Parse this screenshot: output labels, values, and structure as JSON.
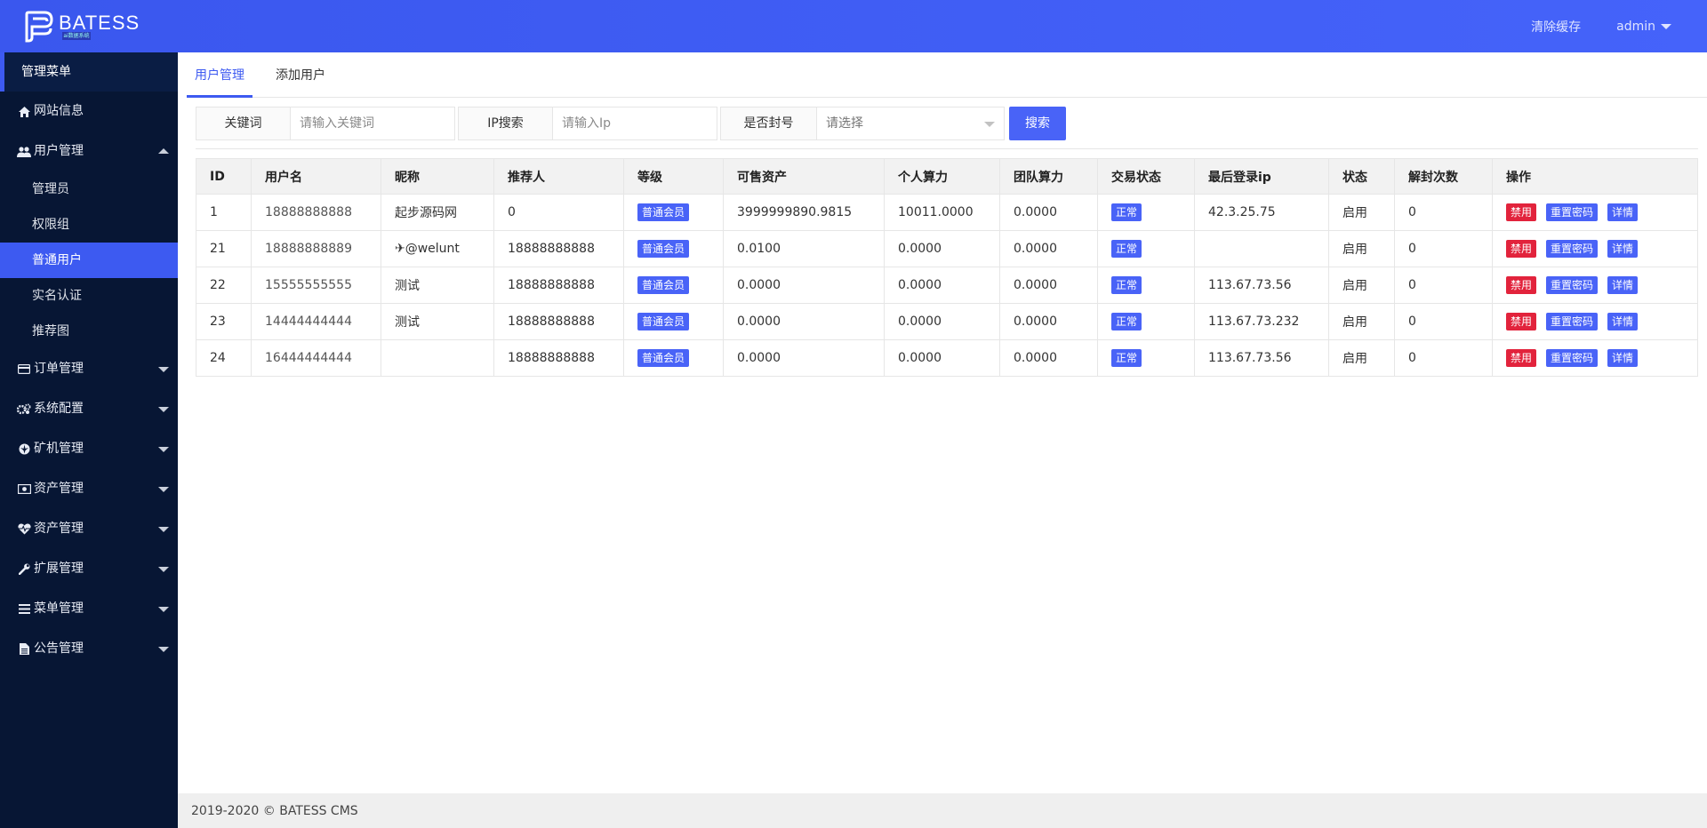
{
  "brand": {
    "title": "BATESS",
    "sub": "ai数据系统",
    "color": "#3d5af1"
  },
  "header": {
    "clear_cache": "清除缓存",
    "user": "admin"
  },
  "sidebar": {
    "title": "管理菜单",
    "items": [
      {
        "label": "网站信息",
        "icon": "home-icon"
      },
      {
        "label": "用户管理",
        "icon": "users-icon",
        "expanded": true,
        "children": [
          "管理员",
          "权限组",
          "普通用户",
          "实名认证",
          "推荐图"
        ],
        "active_child": "普通用户"
      },
      {
        "label": "订单管理",
        "icon": "credit-card-icon"
      },
      {
        "label": "系统配置",
        "icon": "gears-icon"
      },
      {
        "label": "矿机管理",
        "icon": "rebel-icon"
      },
      {
        "label": "资产管理",
        "icon": "money-icon"
      },
      {
        "label": "资产管理",
        "icon": "heartbeat-icon"
      },
      {
        "label": "扩展管理",
        "icon": "wrench-icon"
      },
      {
        "label": "菜单管理",
        "icon": "bars-icon"
      },
      {
        "label": "公告管理",
        "icon": "file-text-icon"
      }
    ]
  },
  "tabs": [
    "用户管理",
    "添加用户"
  ],
  "search": {
    "keyword_label": "关键词",
    "keyword_placeholder": "请输入关键词",
    "ip_label": "IP搜索",
    "ip_placeholder": "请输入Ip",
    "ban_label": "是否封号",
    "ban_placeholder": "请选择",
    "button": "搜索"
  },
  "table": {
    "columns": [
      "ID",
      "用户名",
      "昵称",
      "推荐人",
      "等级",
      "可售资产",
      "个人算力",
      "团队算力",
      "交易状态",
      "最后登录ip",
      "状态",
      "解封次数",
      "操作"
    ],
    "rows": [
      {
        "id": "1",
        "username": "18888888888",
        "nickname": "起步源码网",
        "referrer": "0",
        "level": "普通会员",
        "assets": "3999999890.9815",
        "personal": "10011.0000",
        "team": "0.0000",
        "trade": "正常",
        "ip": "42.3.25.75",
        "status": "启用",
        "unban": "0"
      },
      {
        "id": "21",
        "username": "18888888889",
        "nickname": "✈@welunt",
        "referrer": "18888888888",
        "level": "普通会员",
        "assets": "0.0100",
        "personal": "0.0000",
        "team": "0.0000",
        "trade": "正常",
        "ip": "",
        "status": "启用",
        "unban": "0"
      },
      {
        "id": "22",
        "username": "15555555555",
        "nickname": "测试",
        "referrer": "18888888888",
        "level": "普通会员",
        "assets": "0.0000",
        "personal": "0.0000",
        "team": "0.0000",
        "trade": "正常",
        "ip": "113.67.73.56",
        "status": "启用",
        "unban": "0"
      },
      {
        "id": "23",
        "username": "14444444444",
        "nickname": "测试",
        "referrer": "18888888888",
        "level": "普通会员",
        "assets": "0.0000",
        "personal": "0.0000",
        "team": "0.0000",
        "trade": "正常",
        "ip": "113.67.73.232",
        "status": "启用",
        "unban": "0"
      },
      {
        "id": "24",
        "username": "16444444444",
        "nickname": "",
        "referrer": "18888888888",
        "level": "普通会员",
        "assets": "0.0000",
        "personal": "0.0000",
        "team": "0.0000",
        "trade": "正常",
        "ip": "113.67.73.56",
        "status": "启用",
        "unban": "0"
      }
    ],
    "actions": {
      "disable": "禁用",
      "reset": "重置密码",
      "detail": "详情"
    }
  },
  "footer": "2019-2020 © BATESS CMS"
}
